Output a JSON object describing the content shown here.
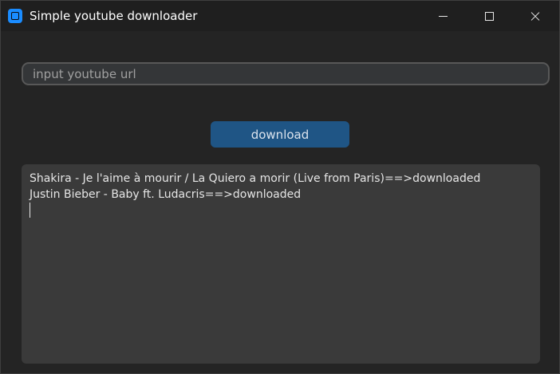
{
  "window": {
    "title": "Simple youtube downloader",
    "controls": [
      "minimize-icon",
      "maximize-icon",
      "close-icon"
    ],
    "accent_color": "#1a8cff"
  },
  "url_input": {
    "value": "",
    "placeholder": "input youtube url"
  },
  "download_button": {
    "label": "download",
    "color": "#1f5585"
  },
  "log": {
    "lines": [
      "Shakira - Je l'aime à mourir / La Quiero a morir (Live from Paris)==>downloaded",
      "Justin Bieber - Baby ft. Ludacris==>downloaded"
    ]
  }
}
